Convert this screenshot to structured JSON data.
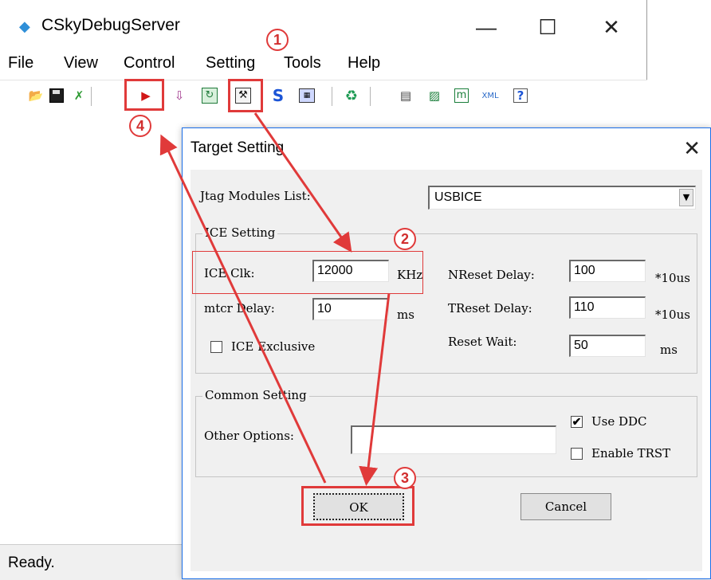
{
  "window": {
    "title": "CSkyDebugServer",
    "min_glyph": "—",
    "max_glyph": "☐",
    "close_glyph": "✕"
  },
  "menu": [
    "File",
    "View",
    "Control",
    "Setting",
    "Tools",
    "Help"
  ],
  "status": {
    "text": "Ready."
  },
  "dialog": {
    "title": "Target Setting",
    "close_glyph": "✕",
    "jtag_label": "Jtag Modules List:",
    "jtag_value": "USBICE",
    "dropdown_arrow": "▼",
    "ice_group_title": "ICE Setting",
    "ice_clk_label": "ICE Clk:",
    "ice_clk_value": "12000",
    "ice_clk_unit": "KHz",
    "mtcr_label": "mtcr Delay:",
    "mtcr_value": "10",
    "mtcr_unit": "ms",
    "ice_exclusive_label": "ICE Exclusive",
    "nreset_label": "NReset Delay:",
    "nreset_value": "100",
    "nreset_unit": "*10us",
    "treset_label": "TReset Delay:",
    "treset_value": "110",
    "treset_unit": "*10us",
    "reset_wait_label": "Reset Wait:",
    "reset_wait_value": "50",
    "reset_wait_unit": "ms",
    "common_group_title": "Common Setting",
    "other_options_label": "Other Options:",
    "other_options_value": "",
    "use_ddc_label": "Use DDC",
    "use_ddc_checked": true,
    "enable_trst_label": "Enable TRST",
    "enable_trst_checked": false,
    "ice_exclusive_checked": false,
    "check_glyph": "✔",
    "ok_label": "OK",
    "cancel_label": "Cancel"
  },
  "annotations": {
    "badge1": "1",
    "badge2": "2",
    "badge3": "3",
    "badge4": "4"
  },
  "colors": {
    "annotation": "#e03a3a",
    "run_icon": "#d11717",
    "dialog_border": "#1a6ee8"
  }
}
